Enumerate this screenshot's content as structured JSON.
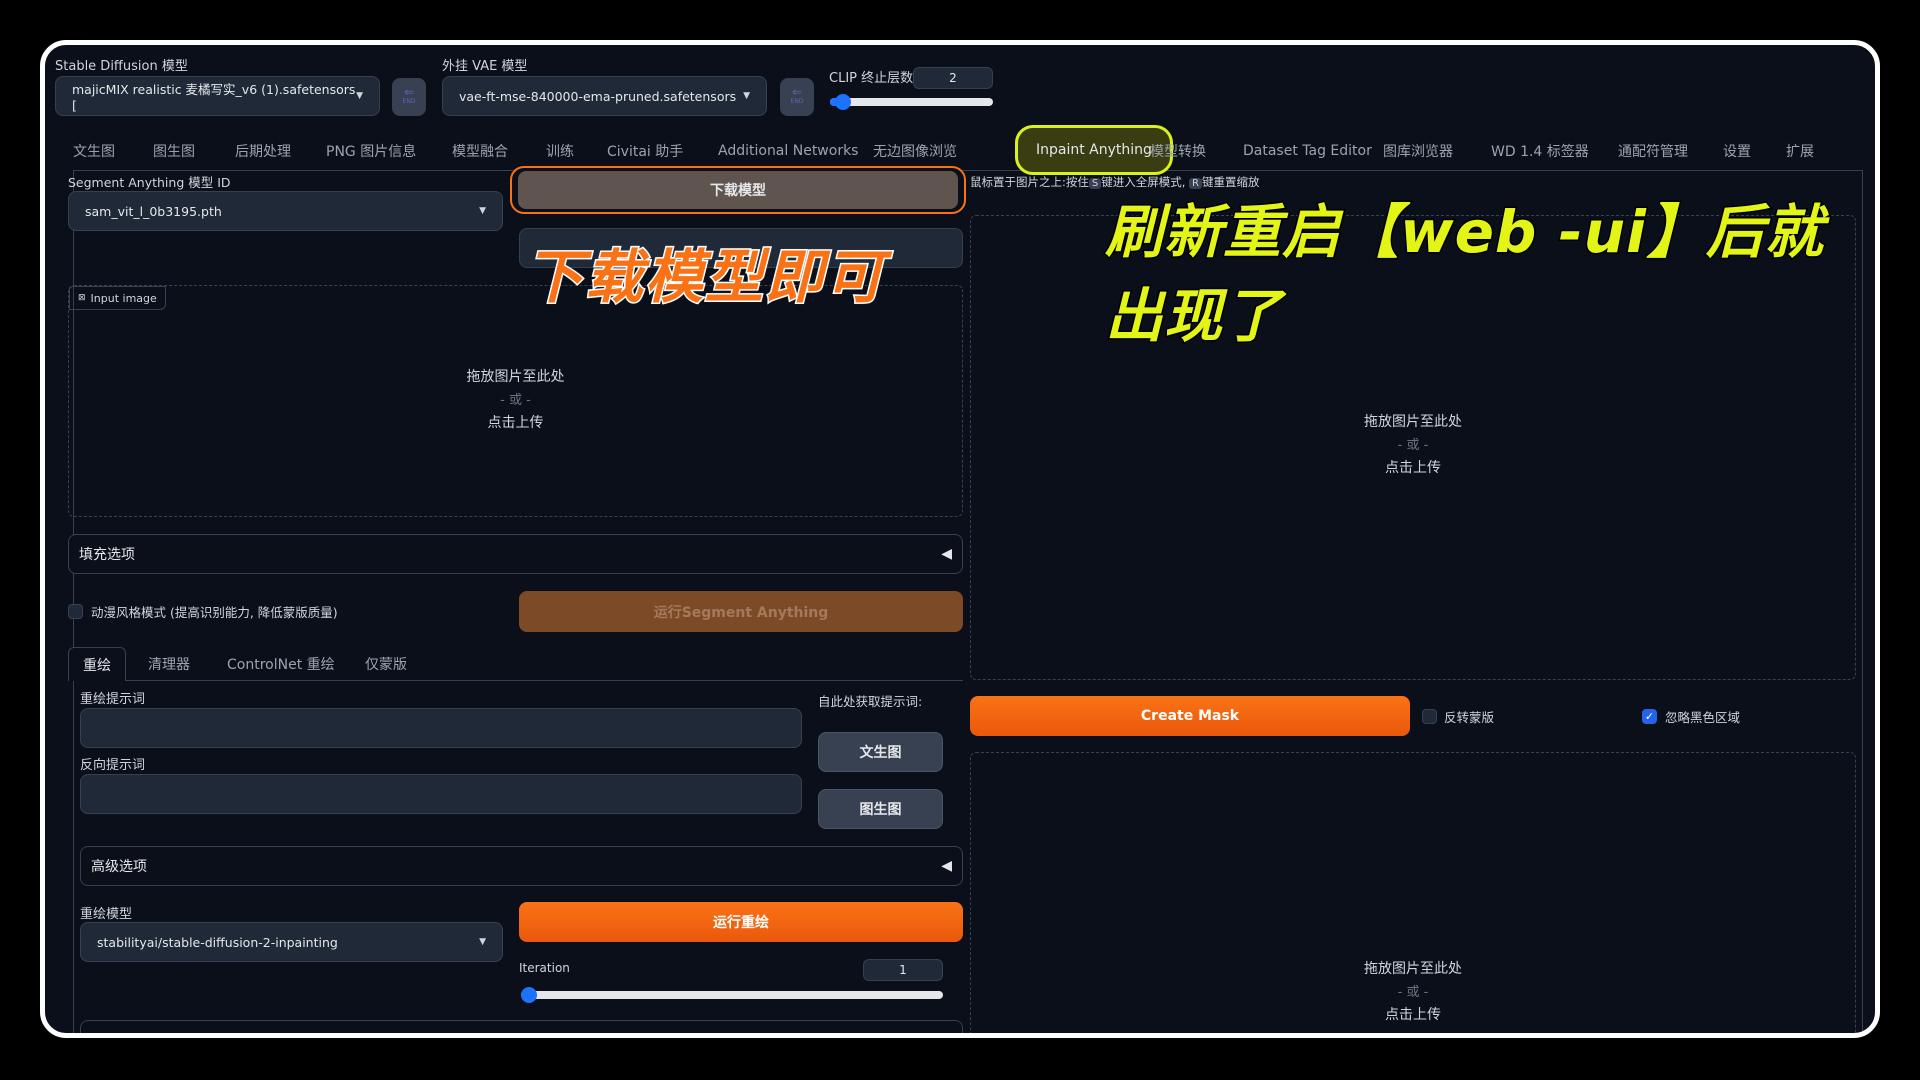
{
  "top": {
    "sd_model": {
      "label": "Stable Diffusion 模型",
      "value": "majicMIX realistic 麦橘写实_v6 (1).safetensors ["
    },
    "vae_model": {
      "label": "外挂 VAE 模型",
      "value": "vae-ft-mse-840000-ema-pruned.safetensors"
    },
    "swap_icon_text": "END",
    "clip": {
      "label": "CLIP 终止层数",
      "value": "2",
      "fraction": 0.08
    }
  },
  "tabs": [
    {
      "label": "文生图"
    },
    {
      "label": "图生图"
    },
    {
      "label": "后期处理"
    },
    {
      "label": "PNG 图片信息"
    },
    {
      "label": "模型融合"
    },
    {
      "label": "训练"
    },
    {
      "label": "Civitai 助手"
    },
    {
      "label": "Additional Networks"
    },
    {
      "label": "无边图像浏览"
    },
    {
      "label": "Inpaint Anything",
      "active": true
    },
    {
      "label": "模型转换"
    },
    {
      "label": "Dataset Tag Editor"
    },
    {
      "label": "图库浏览器"
    },
    {
      "label": "WD 1.4 标签器"
    },
    {
      "label": "通配符管理"
    },
    {
      "label": "设置"
    },
    {
      "label": "扩展"
    }
  ],
  "left": {
    "sam_model": {
      "label": "Segment Anything 模型 ID",
      "value": "sam_vit_l_0b3195.pth"
    },
    "download_button": "下载模型",
    "status_box": "",
    "input_image_label": "Input image",
    "upload": {
      "line1": "拖放图片至此处",
      "or": "- 或 -",
      "line2": "点击上传"
    },
    "fill_options": "填充选项",
    "anime_mode": {
      "label": "动漫风格模式 (提高识别能力, 降低蒙版质量)",
      "checked": false
    },
    "run_sam_button": "运行Segment Anything",
    "subtabs": [
      "重绘",
      "清理器",
      "ControlNet 重绘",
      "仅蒙版"
    ],
    "prompt_label": "重绘提示词",
    "prompt_value": "",
    "negative_label": "反向提示词",
    "negative_value": "",
    "get_prompt_label": "自此处获取提示词:",
    "txt2img_button": "文生图",
    "img2img_button": "图生图",
    "advanced": "高级选项",
    "inpaint_model": {
      "label": "重绘模型",
      "value": "stabilityai/stable-diffusion-2-inpainting"
    },
    "run_inpaint_button": "运行重绘",
    "iteration": {
      "label": "Iteration",
      "value": "1",
      "fraction": 0.0
    }
  },
  "right": {
    "hint": {
      "pre": "鼠标置于图片之上:按住",
      "key1": "S",
      "mid": "键进入全屏模式,",
      "key2": "R",
      "post": "键重置缩放"
    },
    "upload_top": {
      "line1": "拖放图片至此处",
      "or": "- 或 -",
      "line2": "点击上传"
    },
    "create_mask_button": "Create Mask",
    "invert_mask": {
      "label": "反转蒙版",
      "checked": false
    },
    "ignore_black": {
      "label": "忽略黑色区域",
      "checked": true
    },
    "upload_bottom": {
      "line1": "拖放图片至此处",
      "or": "- 或 -",
      "line2": "点击上传"
    }
  },
  "annotations": {
    "download_hint": "下载模型即可",
    "refresh_hint": "刷新重启【web -ui】后就出现了"
  },
  "colors": {
    "accent_orange": "#f97316",
    "highlight_yellow": "#d9f21a",
    "slider_blue": "#1d72ff",
    "background": "#0b0f19"
  }
}
